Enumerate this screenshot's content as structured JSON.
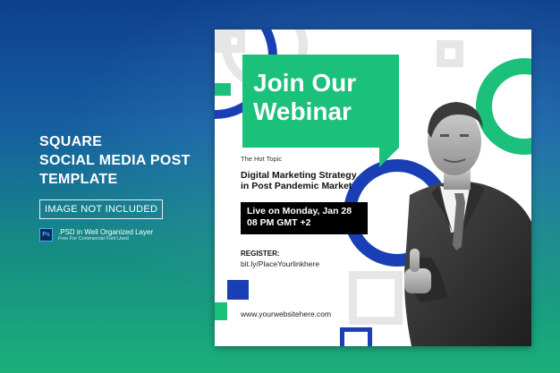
{
  "left_panel": {
    "headline": [
      "SQUARE",
      "SOCIAL MEDIA POST",
      "TEMPLATE"
    ],
    "badge": "IMAGE NOT INCLUDED",
    "ps_icon_text": "Ps",
    "ps_line1": ".PSD in Well Organized Layer",
    "ps_line2": "Free For Commercial Font Used"
  },
  "card": {
    "title_line1": "Join Our",
    "title_line2": "Webinar",
    "topic_label": "The Hot Topic",
    "topic_line1": "Digital Marketing Strategy",
    "topic_line2": "in Post Pandemic Market",
    "live_line1": "Live on Monday, Jan 28",
    "live_line2": "08 PM GMT +2",
    "register_label": "REGISTER:",
    "register_link": "bit.ly/PlaceYourlinkhere",
    "website": "www.yourwebsitehere.com"
  },
  "colors": {
    "accent_green": "#1bc07a",
    "accent_blue": "#1a3fb5",
    "grey_shape": "#e6e6e6"
  }
}
